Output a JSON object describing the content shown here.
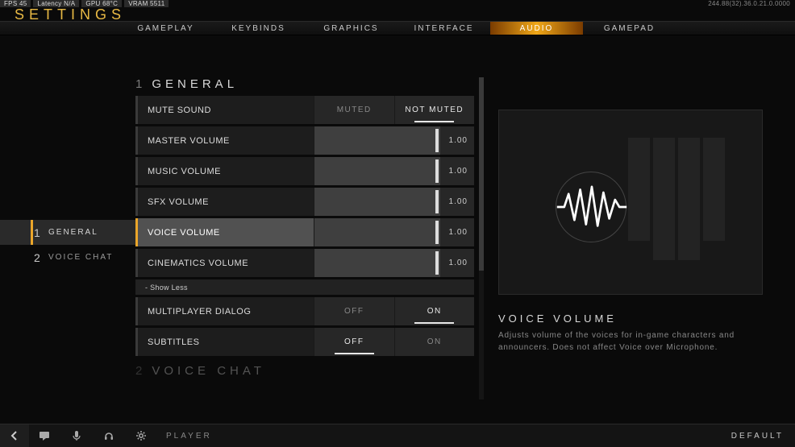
{
  "perf": {
    "fps": "FPS 45",
    "latency": "Latency N/A",
    "gpu": "GPU 68°C",
    "vram": "VRAM 5511",
    "net": "244.88(32).36.0.21.0.0000"
  },
  "page_title": "SETTINGS",
  "tabs": [
    "GAMEPLAY",
    "KEYBINDS",
    "GRAPHICS",
    "INTERFACE",
    "AUDIO",
    "GAMEPAD"
  ],
  "active_tab": "AUDIO",
  "side": [
    {
      "num": "1",
      "label": "GENERAL"
    },
    {
      "num": "2",
      "label": "VOICE CHAT"
    }
  ],
  "section1": {
    "num": "1",
    "title": "GENERAL"
  },
  "rows": {
    "mute": {
      "label": "Mute Sound",
      "opts": [
        "MUTED",
        "NOT MUTED"
      ],
      "value": "NOT MUTED"
    },
    "master": {
      "label": "Master Volume",
      "value": "1.00"
    },
    "music": {
      "label": "Music Volume",
      "value": "1.00"
    },
    "sfx": {
      "label": "SFX Volume",
      "value": "1.00"
    },
    "voice": {
      "label": "Voice Volume",
      "value": "1.00"
    },
    "cine": {
      "label": "Cinematics Volume",
      "value": "1.00"
    },
    "showless": "- Show Less",
    "mpdialog": {
      "label": "Multiplayer Dialog",
      "opts": [
        "OFF",
        "ON"
      ],
      "value": "ON"
    },
    "subtitles": {
      "label": "Subtitles",
      "opts": [
        "OFF",
        "ON"
      ],
      "value": "OFF"
    }
  },
  "section2": {
    "num": "2",
    "title": "VOICE CHAT"
  },
  "detail": {
    "title": "VOICE VOLUME",
    "desc": "Adjusts volume of the voices for in-game characters and announcers. Does not affect Voice over Microphone."
  },
  "bottom": {
    "player": "PLAYER",
    "default": "DEFAULT"
  }
}
